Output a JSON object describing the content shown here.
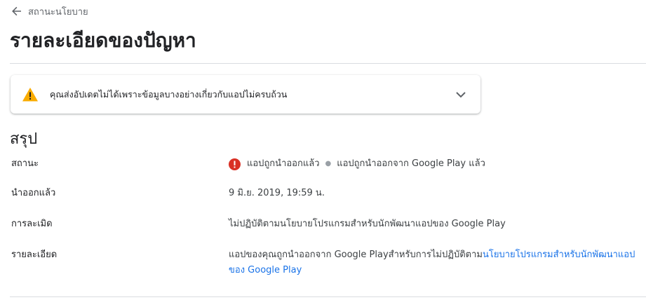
{
  "back": {
    "label": "สถานะนโยบาย"
  },
  "page_title": "รายละเอียดของปัญหา",
  "warning": {
    "text": "คุณส่งอัปเดตไม่ได้เพราะข้อมูลบางอย่างเกี่ยวกับแอปไม่ครบถ้วน",
    "color": "#f9ab00"
  },
  "summary": {
    "title": "สรุป",
    "status": {
      "label": "สถานะ",
      "primary": "แอปถูกนำออกแล้ว",
      "secondary": "แอปถูกนำออกจาก Google Play แล้ว",
      "color": "#d93025"
    },
    "removed": {
      "label": "นำออกแล้ว",
      "value": "9 มิ.ย. 2019, 19:59 น."
    },
    "violation": {
      "label": "การละเมิด",
      "value": "ไม่ปฏิบัติตามนโยบายโปรแกรมสำหรับนักพัฒนาแอปของ Google Play"
    },
    "details": {
      "label": "รายละเอียด",
      "text": "แอปของคุณถูกนำออกจาก Google Playสำหรับการไม่ปฏิบัติตาม",
      "link": "นโยบายโปรแกรมสำหรับนักพัฒนาแอปของ Google Play",
      "link_color": "#1a73e8"
    }
  }
}
